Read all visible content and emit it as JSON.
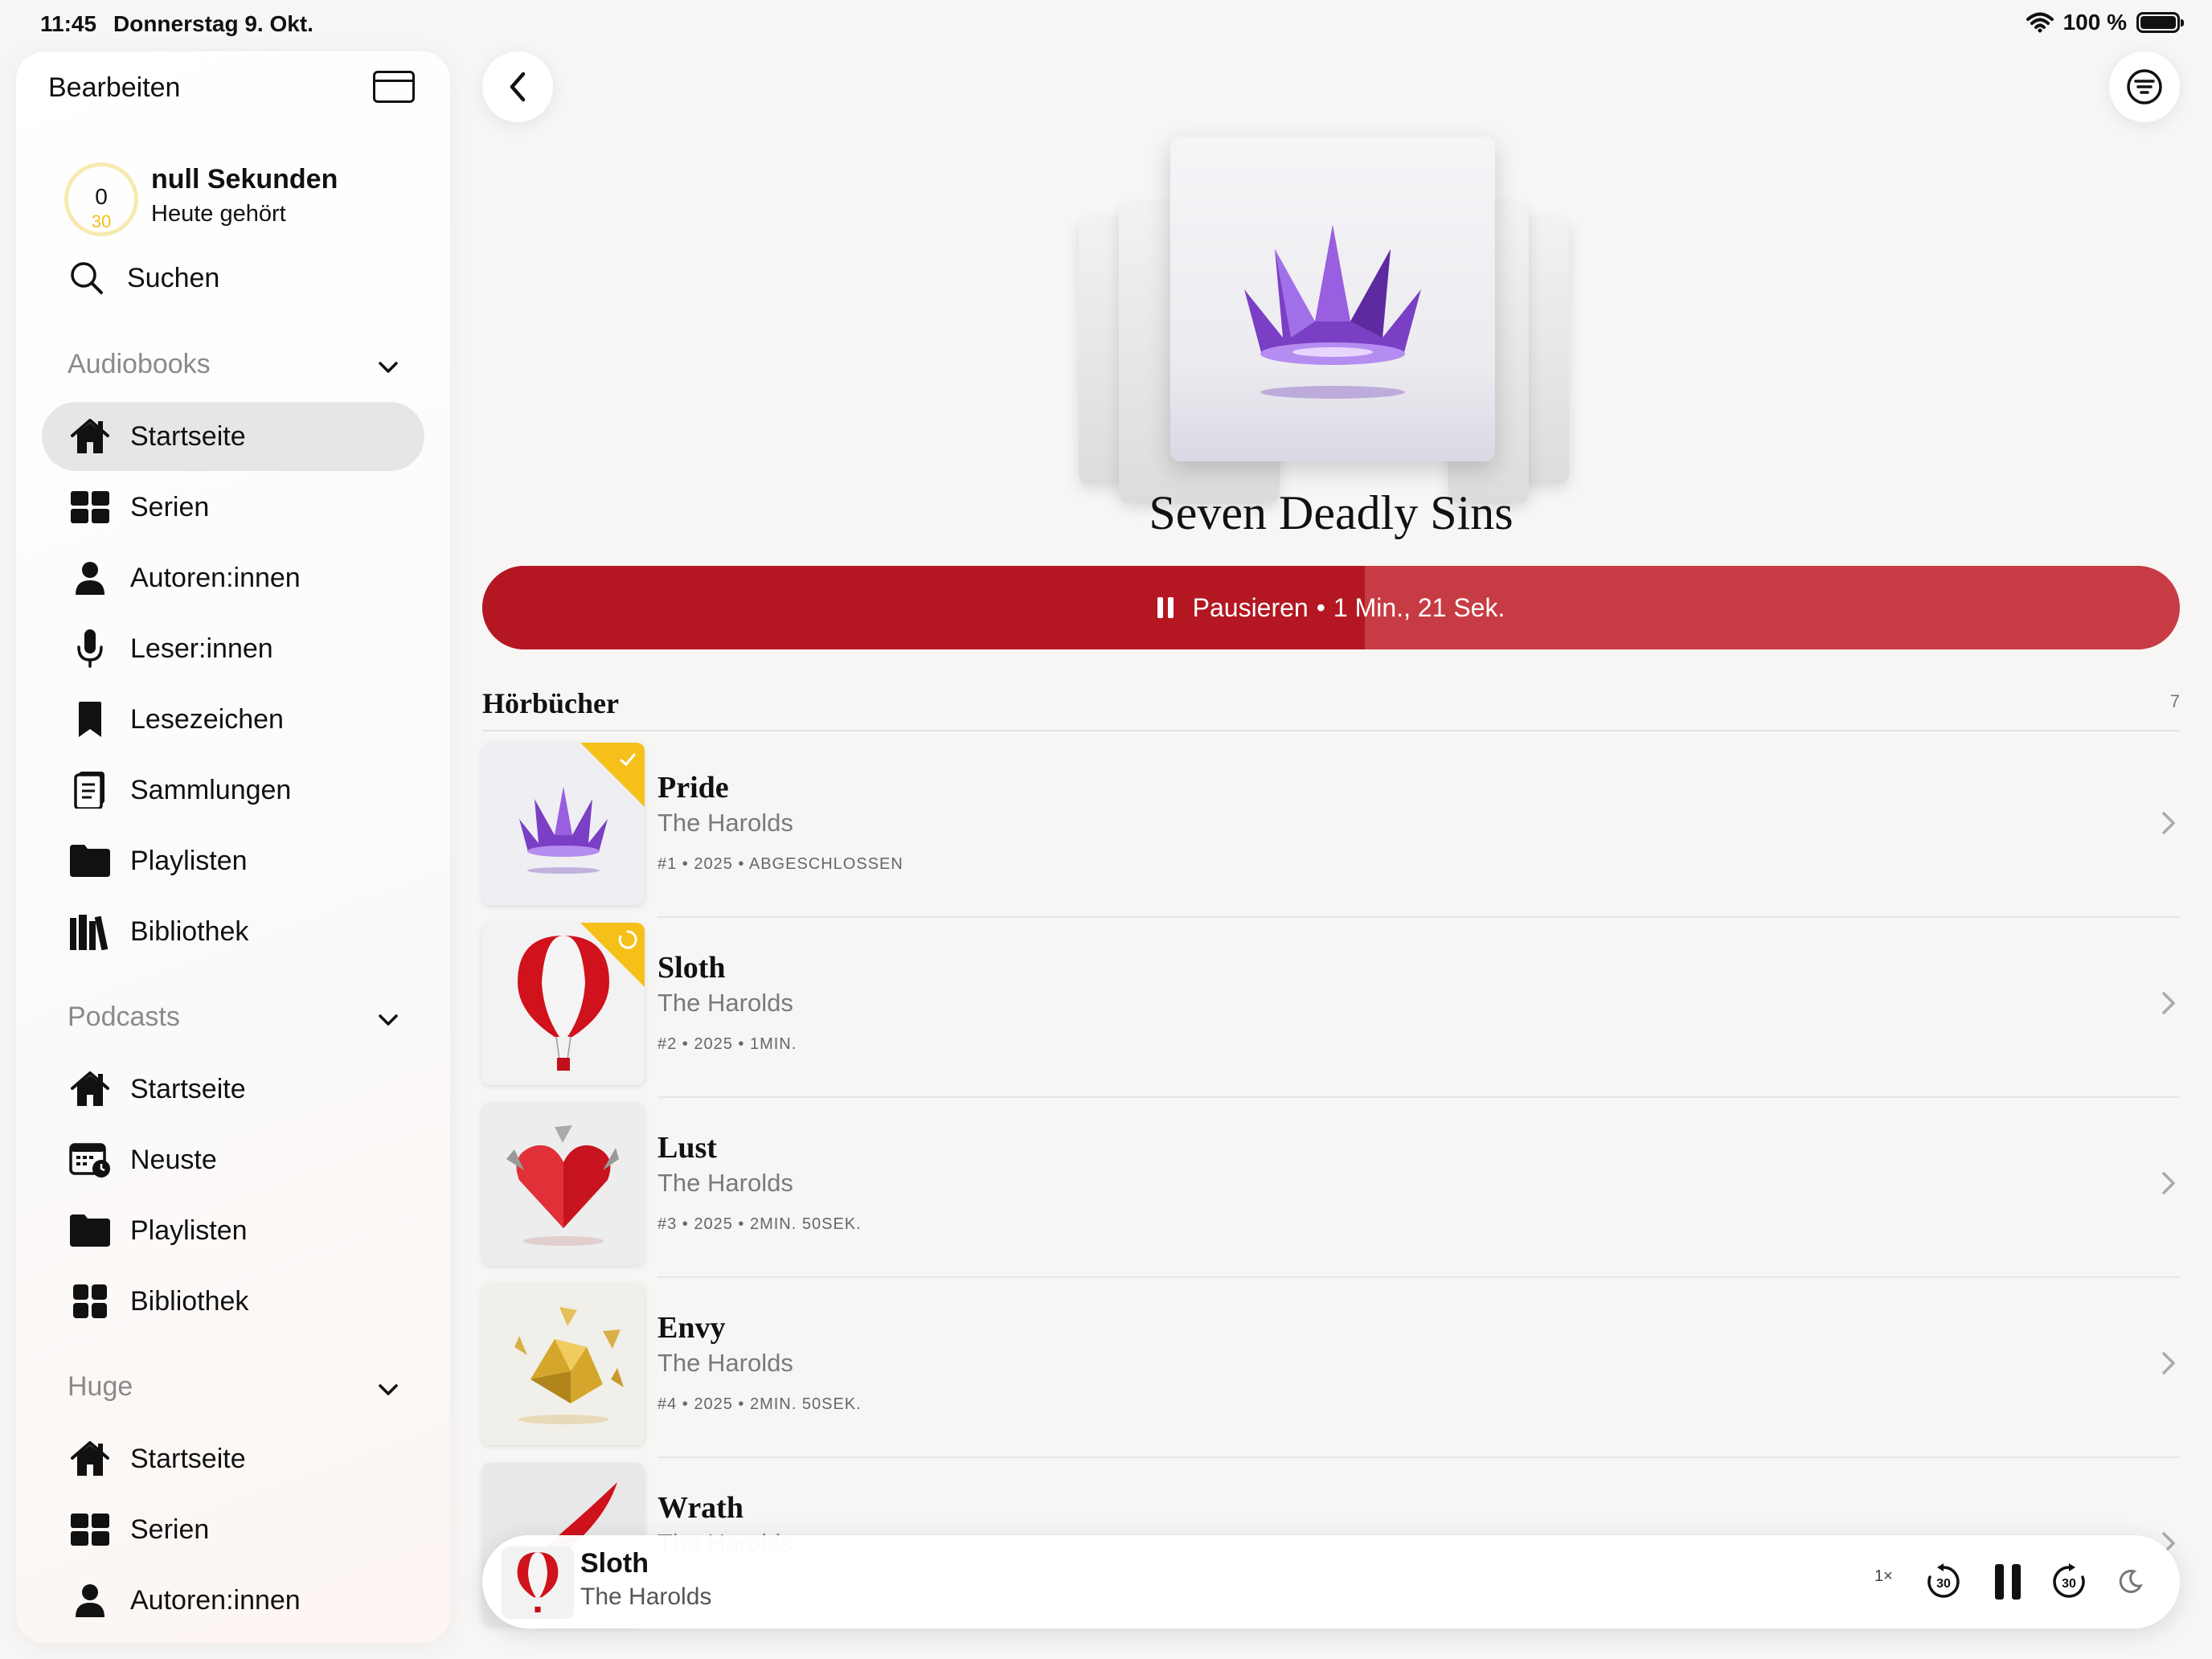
{
  "status": {
    "time": "11:45",
    "date": "Donnerstag 9. Okt.",
    "battery": "100 %"
  },
  "sidebar": {
    "edit_label": "Bearbeiten",
    "listening": {
      "ring_value": "0",
      "ring_goal": "30",
      "title": "null Sekunden",
      "subtitle": "Heute gehört"
    },
    "search_label": "Suchen",
    "sections": [
      {
        "title": "Audiobooks",
        "items": [
          {
            "label": "Startseite",
            "icon": "house-icon",
            "active": true
          },
          {
            "label": "Serien",
            "icon": "grid-icon"
          },
          {
            "label": "Autoren:innen",
            "icon": "person-icon"
          },
          {
            "label": "Leser:innen",
            "icon": "microphone-icon"
          },
          {
            "label": "Lesezeichen",
            "icon": "bookmark-icon"
          },
          {
            "label": "Sammlungen",
            "icon": "book-stack-icon"
          },
          {
            "label": "Playlisten",
            "icon": "folder-icon"
          },
          {
            "label": "Bibliothek",
            "icon": "library-icon"
          }
        ]
      },
      {
        "title": "Podcasts",
        "items": [
          {
            "label": "Startseite",
            "icon": "house-icon"
          },
          {
            "label": "Neuste",
            "icon": "calendar-clock-icon"
          },
          {
            "label": "Playlisten",
            "icon": "folder-icon"
          },
          {
            "label": "Bibliothek",
            "icon": "squares-icon"
          }
        ]
      },
      {
        "title": "Huge",
        "items": [
          {
            "label": "Startseite",
            "icon": "house-icon"
          },
          {
            "label": "Serien",
            "icon": "grid-icon"
          },
          {
            "label": "Autoren:innen",
            "icon": "person-icon"
          }
        ]
      }
    ]
  },
  "main": {
    "series_title": "Seven Deadly Sins",
    "play_button": {
      "label": "Pausieren",
      "separator": "•",
      "remaining": "1 Min., 21 Sek.",
      "progress": 0.52
    },
    "section": {
      "title": "Hörbücher",
      "count": "7"
    },
    "books": [
      {
        "title": "Pride",
        "author": "The Harolds",
        "meta": "#1 • 2025 • ABGESCHLOSSEN",
        "badge": "check",
        "art": "crown"
      },
      {
        "title": "Sloth",
        "author": "The Harolds",
        "meta": "#2 • 2025 • 1MIN.",
        "badge": "progress",
        "art": "balloon"
      },
      {
        "title": "Lust",
        "author": "The Harolds",
        "meta": "#3 • 2025 • 2MIN. 50SEK.",
        "badge": "none",
        "art": "heart"
      },
      {
        "title": "Envy",
        "author": "The Harolds",
        "meta": "#4 • 2025 • 2MIN. 50SEK.",
        "badge": "none",
        "art": "gold"
      },
      {
        "title": "Wrath",
        "author": "The Harolds",
        "meta": "",
        "badge": "none",
        "art": "feather"
      }
    ]
  },
  "mini_player": {
    "title": "Sloth",
    "author": "The Harolds",
    "speed": "1×",
    "skip_back": "30",
    "skip_forward": "30"
  },
  "colors": {
    "accent_red": "#b41722",
    "accent_red_light": "#c73c44",
    "badge_yellow": "#f6c01a"
  }
}
